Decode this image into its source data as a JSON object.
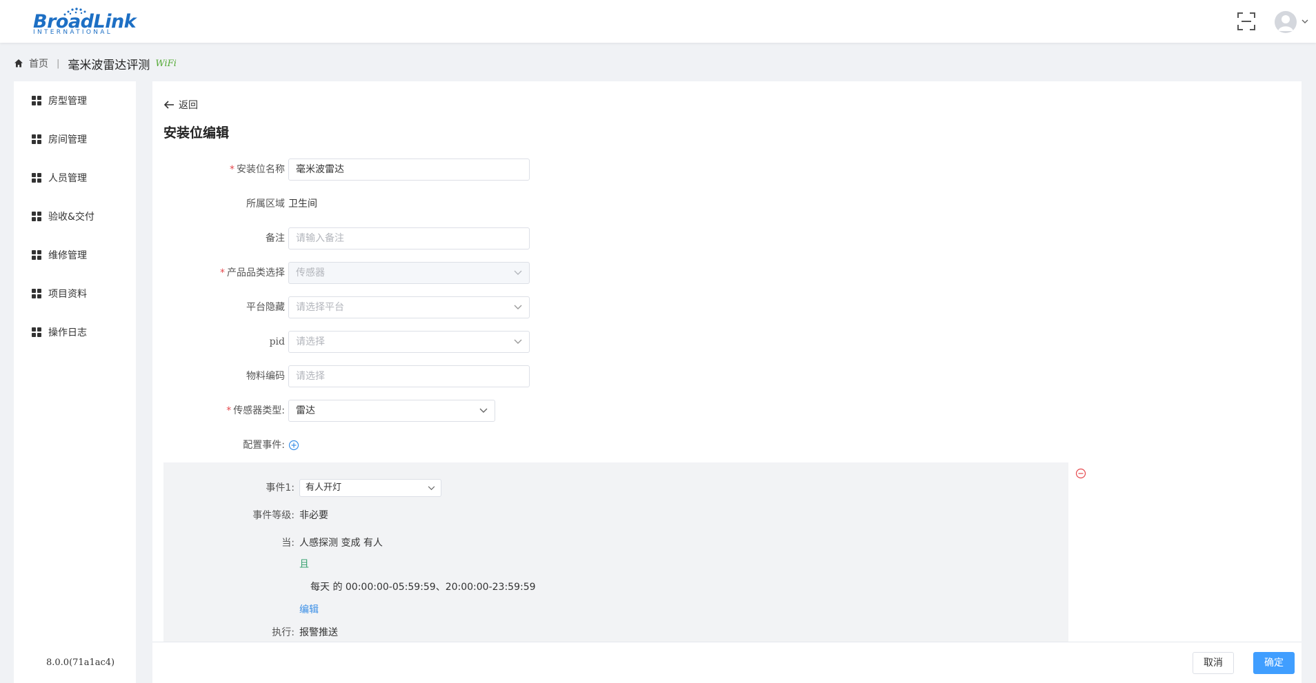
{
  "header": {
    "logo_text": "BroadLink",
    "logo_sub": "INTERNATIONAL",
    "fullscreen_icon": "fullscreen-icon",
    "user_icon": "user-avatar-icon"
  },
  "breadcrumb": {
    "home": "首页",
    "separator": "|",
    "title": "毫米波雷达评测",
    "tag": "WiFi"
  },
  "sidebar": {
    "items": [
      {
        "label": "房型管理"
      },
      {
        "label": "房间管理"
      },
      {
        "label": "人员管理"
      },
      {
        "label": "验收&交付"
      },
      {
        "label": "维修管理"
      },
      {
        "label": "项目资料"
      },
      {
        "label": "操作日志"
      }
    ],
    "version": "8.0.0(71a1ac4)"
  },
  "main": {
    "back_label": "返回",
    "title": "安装位编辑"
  },
  "form": {
    "name": {
      "label": "安装位名称",
      "required": "*",
      "value": "毫米波雷达"
    },
    "area": {
      "label": "所属区域",
      "value": "卫生间"
    },
    "note": {
      "label": "备注",
      "placeholder": "请输入备注"
    },
    "category": {
      "label": "产品品类选择",
      "required": "*",
      "value": "传感器"
    },
    "platform": {
      "label": "平台隐藏",
      "placeholder": "请选择平台"
    },
    "pid": {
      "label": "pid",
      "placeholder": "请选择"
    },
    "material": {
      "label": "物料编码",
      "placeholder": "请选择"
    },
    "sensor_type": {
      "label": "传感器类型:",
      "required": "*",
      "value": "雷达"
    },
    "events": {
      "label": "配置事件:"
    }
  },
  "event": {
    "name_label": "事件1:",
    "name_value": "有人开灯",
    "level_label": "事件等级:",
    "level_value": "非必要",
    "when_label": "当:",
    "when_value": "人感探测 变成 有人",
    "and_label": "且",
    "time_value": "每天 的 00:00:00-05:59:59、20:00:00-23:59:59",
    "edit_label": "编辑",
    "exec_label": "执行:",
    "exec_value": "报警推送"
  },
  "footer": {
    "cancel": "取消",
    "ok": "确定"
  },
  "colors": {
    "primary": "#409eff",
    "required": "#e5484d",
    "link_green": "#36a06e",
    "logo_blue": "#1d6fc4"
  }
}
